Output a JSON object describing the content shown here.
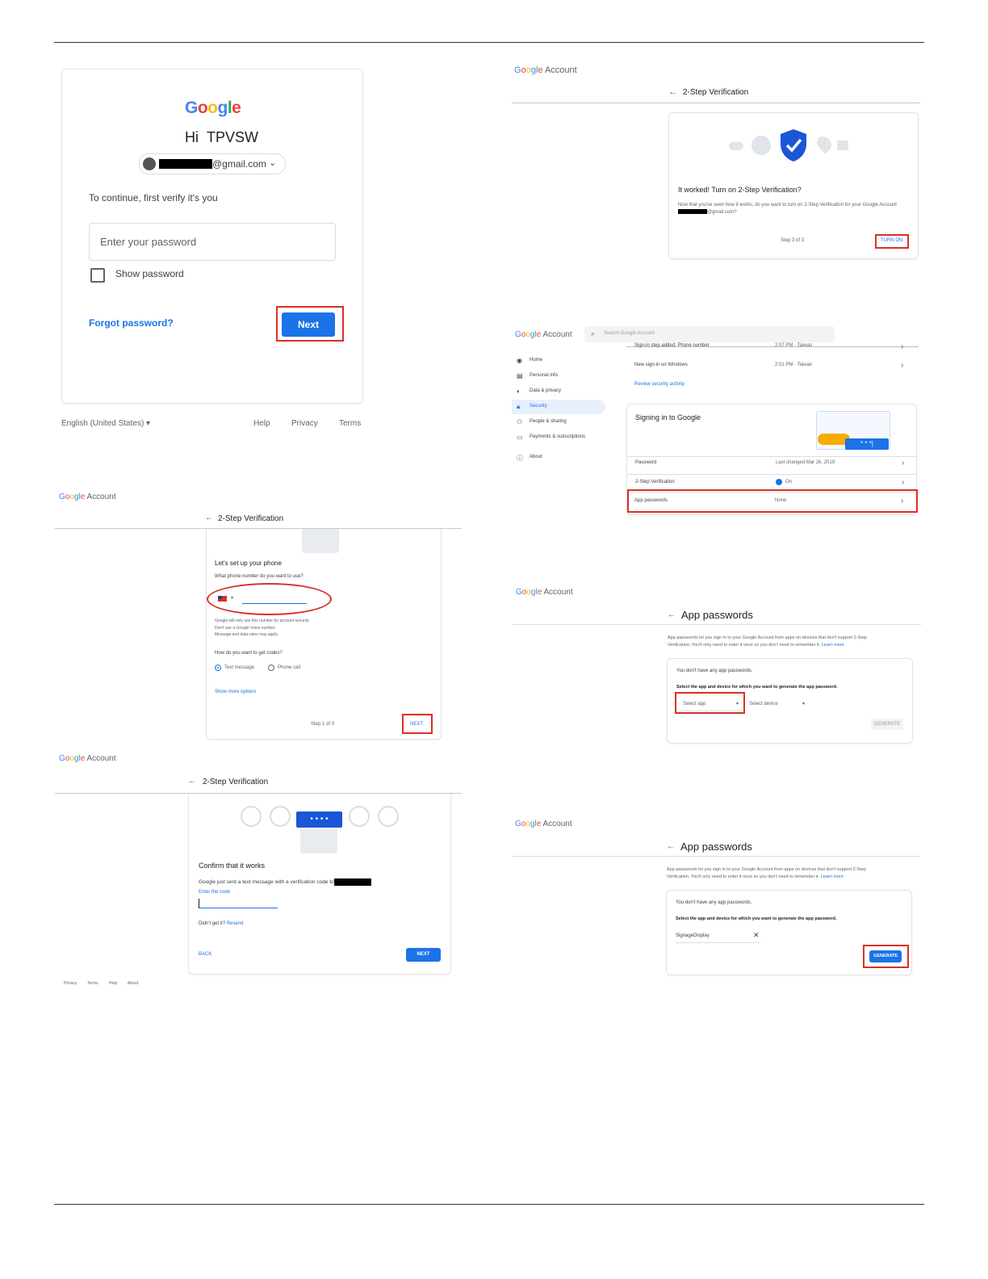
{
  "signin": {
    "logo": "Google",
    "greeting": "Hi",
    "username": "TPVSW",
    "email_suffix": "@gmail.com",
    "verify_text": "To continue, first verify it's you",
    "password_placeholder": "Enter your password",
    "show_password_label": "Show password",
    "forgot_link": "Forgot password?",
    "next_button": "Next",
    "footer": {
      "language": "English (United States)",
      "help": "Help",
      "privacy": "Privacy",
      "terms": "Terms"
    }
  },
  "turn_on": {
    "brand": "Account",
    "header_title": "2-Step Verification",
    "heading": "It worked! Turn on 2-Step Verification?",
    "body_pre": "Now that you've seen how it works, do you want to turn on 2-Step Verification for your Google Account",
    "body_suffix": "@gmail.com?",
    "step": "Step 3 of 3",
    "turn_on_button": "TURN ON"
  },
  "security": {
    "brand": "Account",
    "search_placeholder": "Search Google Account",
    "nav": [
      {
        "label": "Home",
        "icon": "person-circle-icon"
      },
      {
        "label": "Personal info",
        "icon": "id-card-icon"
      },
      {
        "label": "Data & privacy",
        "icon": "toggle-icon"
      },
      {
        "label": "Security",
        "icon": "lock-icon"
      },
      {
        "label": "People & sharing",
        "icon": "people-icon"
      },
      {
        "label": "Payments & subscriptions",
        "icon": "credit-card-icon"
      },
      {
        "label": "About",
        "icon": "info-icon"
      }
    ],
    "activity_top": {
      "label": "Sign-in step added: Phone number",
      "time": "2:07 PM · Taiwan"
    },
    "activity_row": {
      "label": "New sign-in on Windows",
      "time": "2:01 PM · Taiwan"
    },
    "review_link": "Review security activity",
    "signing_title": "Signing in to Google",
    "rows": [
      {
        "label": "Password",
        "value": "Last changed Mar 26, 2019"
      },
      {
        "label": "2-Step Verification",
        "value": "On"
      },
      {
        "label": "App passwords",
        "value": "None"
      }
    ],
    "illustration_text": "* * *|"
  },
  "setup_phone": {
    "brand": "Account",
    "header_title": "2-Step Verification",
    "heading": "Let's set up your phone",
    "question": "What phone number do you want to use?",
    "note_lines": [
      "Google will only use this number for account security.",
      "Don't use a Google Voice number.",
      "Message and data rates may apply."
    ],
    "codes_question": "How do you want to get codes?",
    "option_text": "Text message",
    "option_call": "Phone call",
    "more_options": "Show more options",
    "step": "Step 1 of 3",
    "next_button": "NEXT"
  },
  "app_pw_select": {
    "brand": "Account",
    "title": "App passwords",
    "desc_line1": "App passwords let you sign in to your Google Account from apps on devices that don't support 2-Step",
    "desc_line2": "Verification. You'll only need to enter it once so you don't need to remember it.",
    "learn_more": "Learn more",
    "no_passwords": "You don't have any app passwords.",
    "select_prompt": "Select the app and device for which you want to generate the app password.",
    "select_app": "Select app",
    "select_device": "Select device",
    "generate_button": "GENERATE"
  },
  "confirm": {
    "brand": "Account",
    "header_title": "2-Step Verification",
    "heading": "Confirm that it works",
    "sent_text": "Google just sent a text message with a verification code to",
    "enter_code_label": "Enter the code",
    "didnt_get": "Didn't get it?",
    "resend": "Resend",
    "back_button": "BACK",
    "next_button": "NEXT",
    "code_dots": "• • • •",
    "footer": [
      "Privacy",
      "Terms",
      "Help",
      "About"
    ]
  },
  "app_pw_generate": {
    "brand": "Account",
    "title": "App passwords",
    "desc_line1": "App passwords let you sign in to your Google Account from apps on devices that don't support 2-Step",
    "desc_line2": "Verification. You'll only need to enter it once so you don't need to remember it.",
    "learn_more": "Learn more",
    "no_passwords": "You don't have any app passwords.",
    "select_prompt": "Select the app and device for which you want to generate the app password.",
    "custom_name": "SignageDisplay",
    "generate_button": "GENERATE"
  },
  "colors": {
    "accent": "#1a73e8",
    "highlight": "#d93025"
  }
}
